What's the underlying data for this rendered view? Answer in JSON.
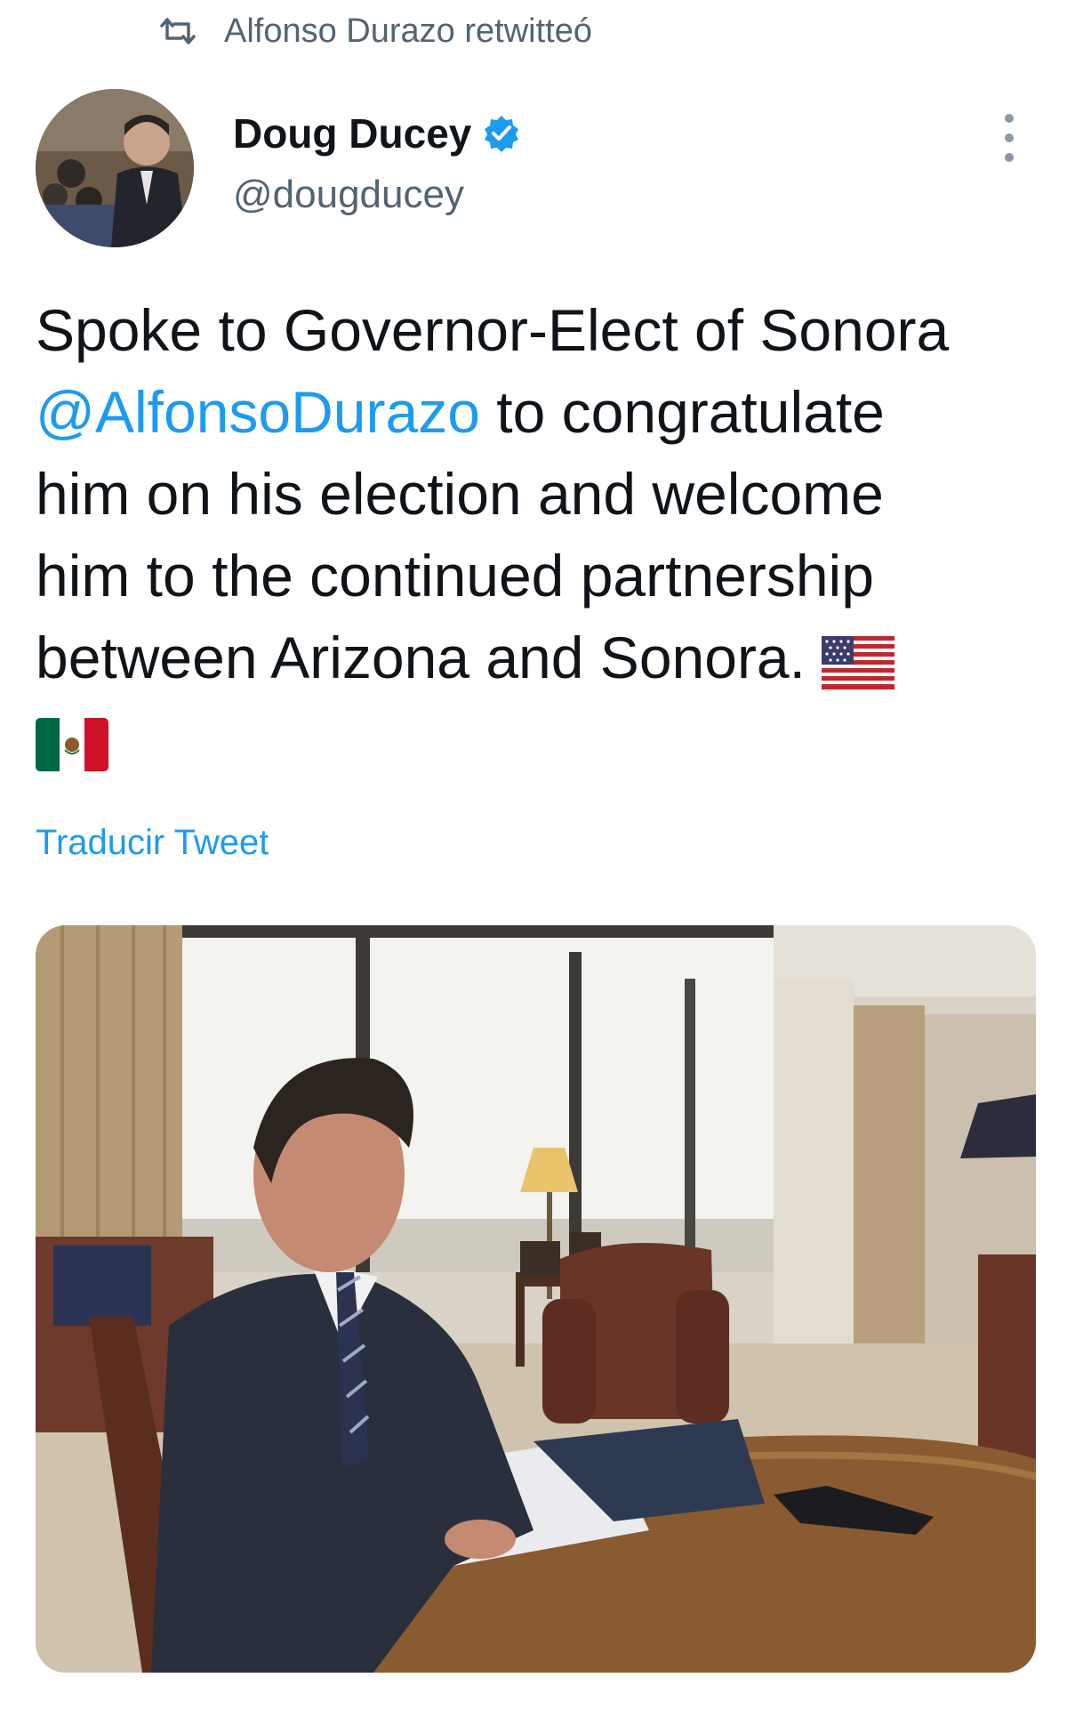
{
  "social_context": {
    "icon": "retweet-icon",
    "text": "Alfonso Durazo retwitteó"
  },
  "author": {
    "display_name": "Doug Ducey",
    "handle": "@dougducey",
    "verified": true,
    "verified_color": "#1d9bf0"
  },
  "tweet": {
    "text_part1": "Spoke to Governor-Elect of Sonora\n",
    "mention": "@AlfonsoDurazo",
    "text_part2": " to congratulate\nhim on his election and welcome\nhim to the continued partnership\nbetween Arizona and Sonora. ",
    "emoji": [
      "us-flag-icon",
      "mexico-flag-icon"
    ],
    "link_color": "#1d9bf0"
  },
  "translate_label": "Traducir Tweet",
  "media": {
    "type": "photo",
    "description_icon": "photo-image"
  }
}
